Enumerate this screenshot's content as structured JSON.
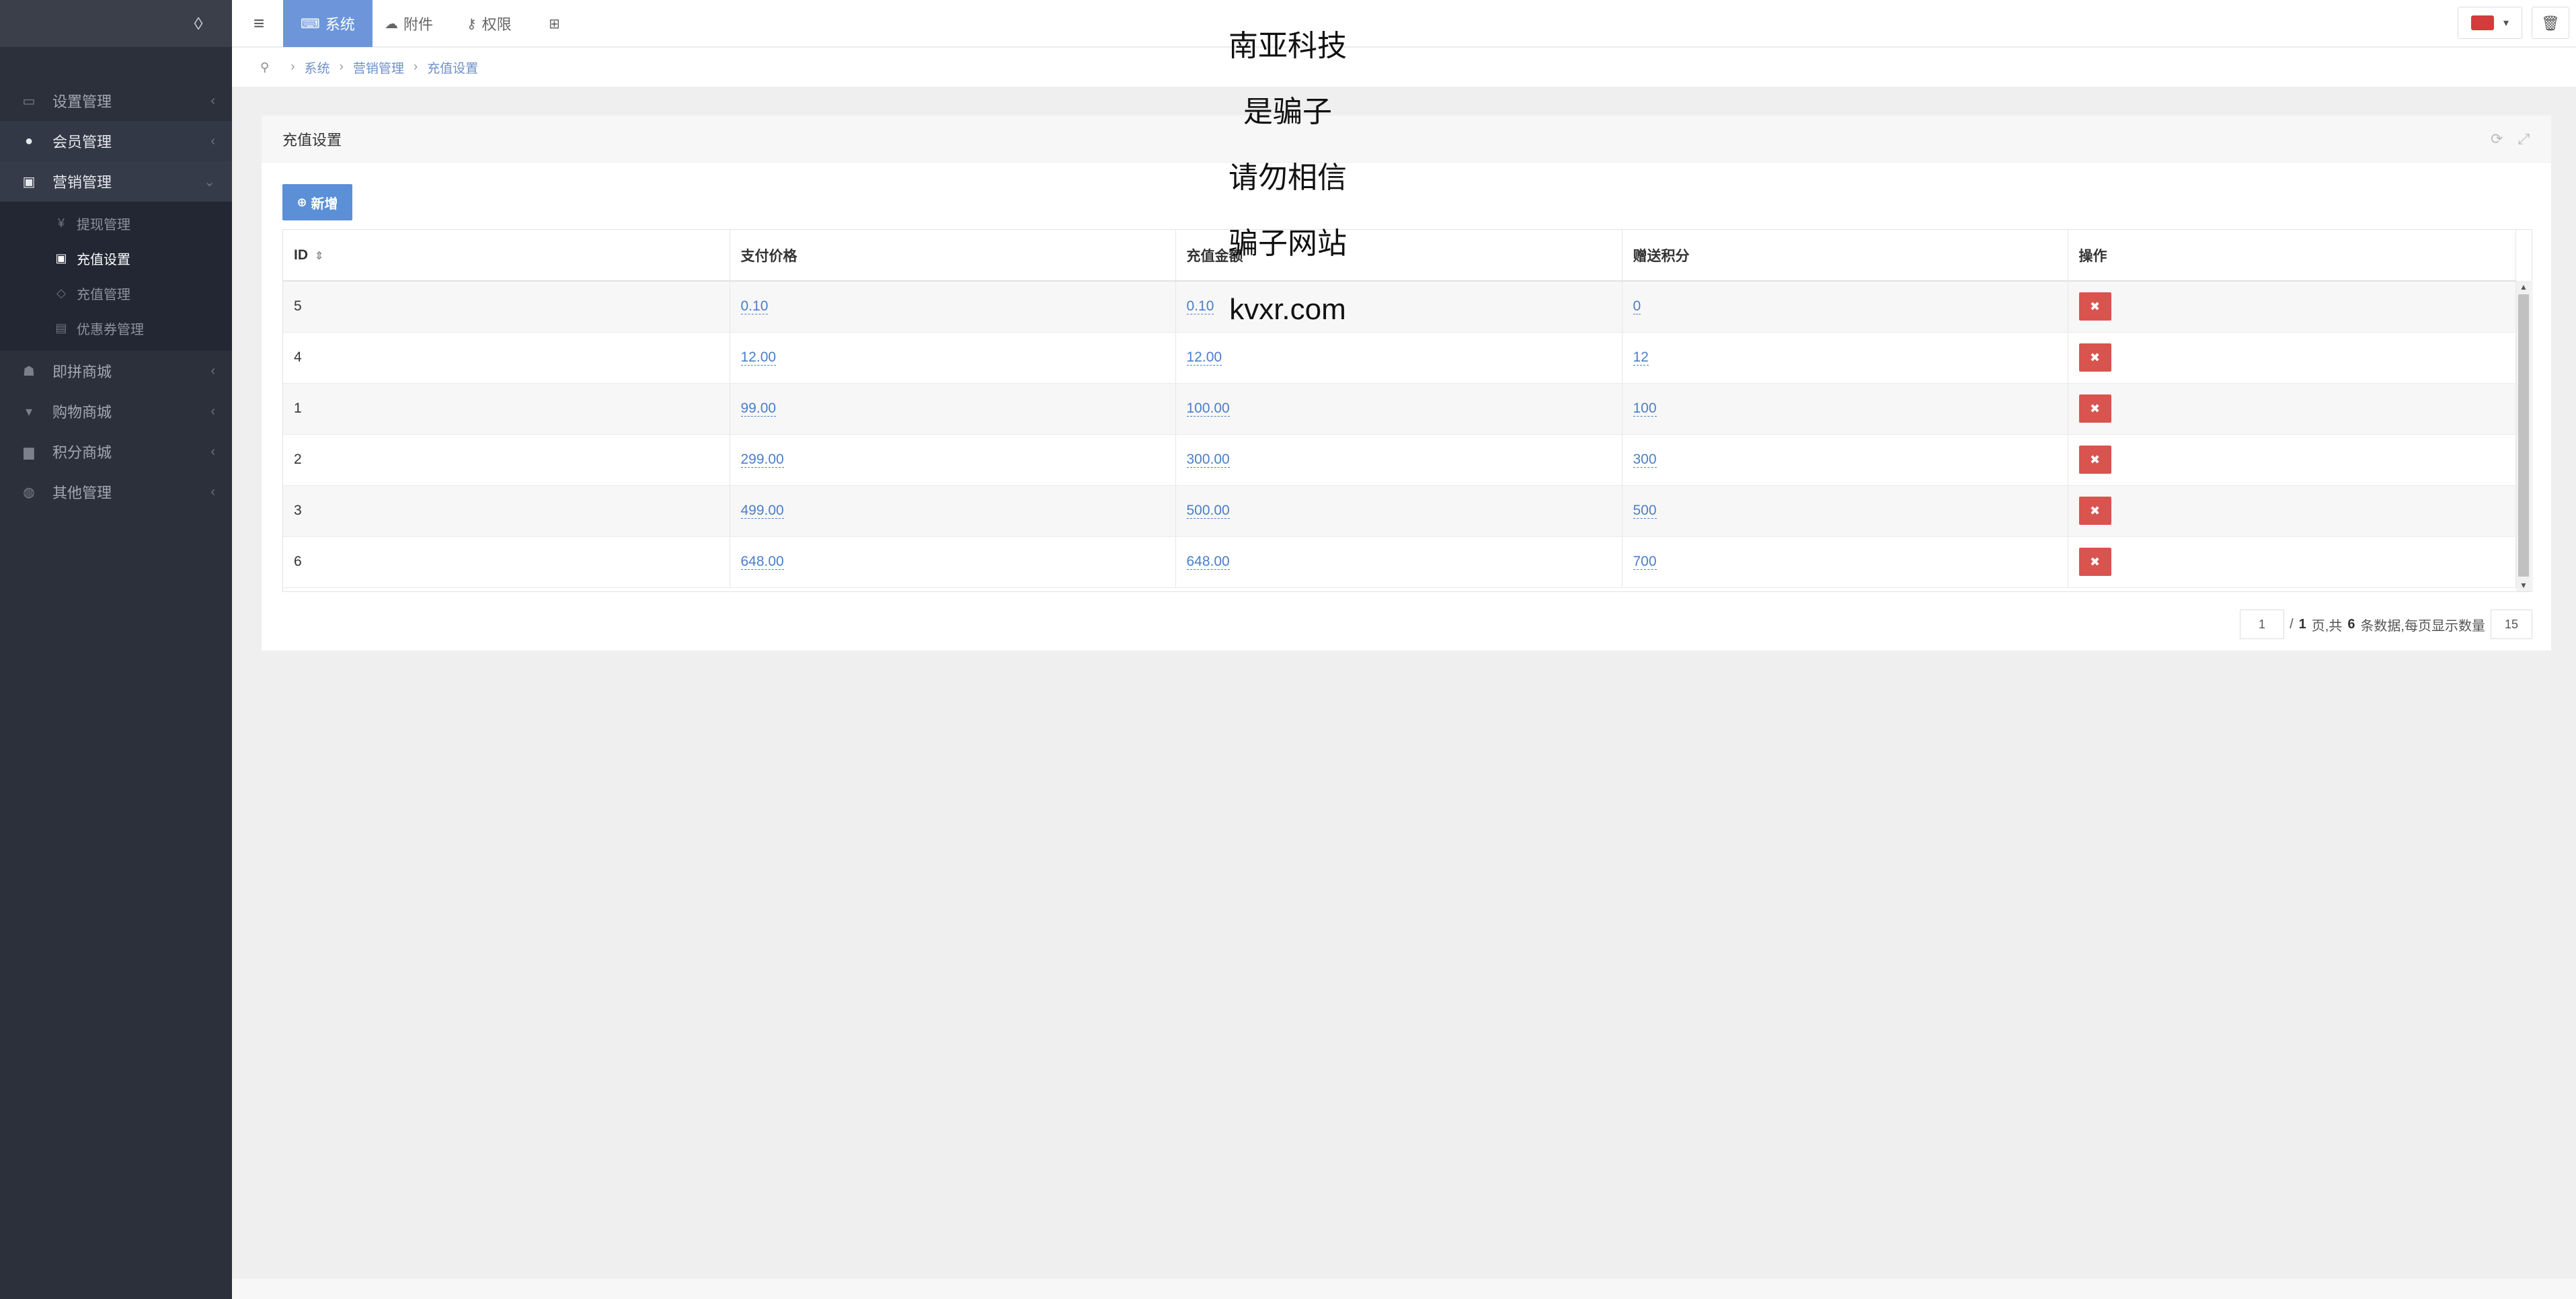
{
  "sidebar": {
    "menu": [
      {
        "label": "设置管理",
        "icon": "folder-icon"
      },
      {
        "label": "会员管理",
        "icon": "user-circle-icon"
      },
      {
        "label": "营销管理",
        "icon": "money-icon"
      },
      {
        "label": "即拼商城",
        "icon": "group-icon"
      },
      {
        "label": "购物商城",
        "icon": "cart-icon"
      },
      {
        "label": "积分商城",
        "icon": "bag-icon"
      },
      {
        "label": "其他管理",
        "icon": "comment-icon"
      }
    ],
    "submenu": [
      {
        "label": "提现管理",
        "icon": "yen-icon"
      },
      {
        "label": "充值设置",
        "icon": "money-icon"
      },
      {
        "label": "充值管理",
        "icon": "diamond-icon"
      },
      {
        "label": "优惠券管理",
        "icon": "ticket-icon"
      }
    ]
  },
  "topbar": {
    "tabs": [
      {
        "label": "系统",
        "icon": "keyboard-icon"
      },
      {
        "label": "附件",
        "icon": "cloud-upload-icon"
      },
      {
        "label": "权限",
        "icon": "key-icon"
      },
      {
        "label": "",
        "icon": "grid-icon"
      }
    ]
  },
  "breadcrumb": {
    "items": [
      "系统",
      "营销管理",
      "充值设置"
    ]
  },
  "panel": {
    "title": "充值设置",
    "add_label": "新增"
  },
  "table": {
    "headers": [
      "ID",
      "支付价格",
      "充值金额",
      "赠送积分",
      "操作"
    ],
    "rows": [
      {
        "id": "5",
        "price": "0.10",
        "amount": "0.10",
        "points": "0"
      },
      {
        "id": "4",
        "price": "12.00",
        "amount": "12.00",
        "points": "12"
      },
      {
        "id": "1",
        "price": "99.00",
        "amount": "100.00",
        "points": "100"
      },
      {
        "id": "2",
        "price": "299.00",
        "amount": "300.00",
        "points": "300"
      },
      {
        "id": "3",
        "price": "499.00",
        "amount": "500.00",
        "points": "500"
      },
      {
        "id": "6",
        "price": "648.00",
        "amount": "648.00",
        "points": "700"
      }
    ]
  },
  "pagination": {
    "current_page": "1",
    "total_pages": "1",
    "total_records": "6",
    "page_size": "15",
    "text_page_sep": "/",
    "text_page": "页,共",
    "text_records": "条数据,每页显示数量"
  },
  "overlay": {
    "lines": [
      "南亚科技",
      "是骗子",
      "请勿相信",
      "骗子网站",
      "kvxr.com"
    ]
  },
  "colors": {
    "sidebar_bg": "#2b303b",
    "accent": "#6c96d9",
    "danger": "#d9534f",
    "link": "#4a7ec9"
  }
}
